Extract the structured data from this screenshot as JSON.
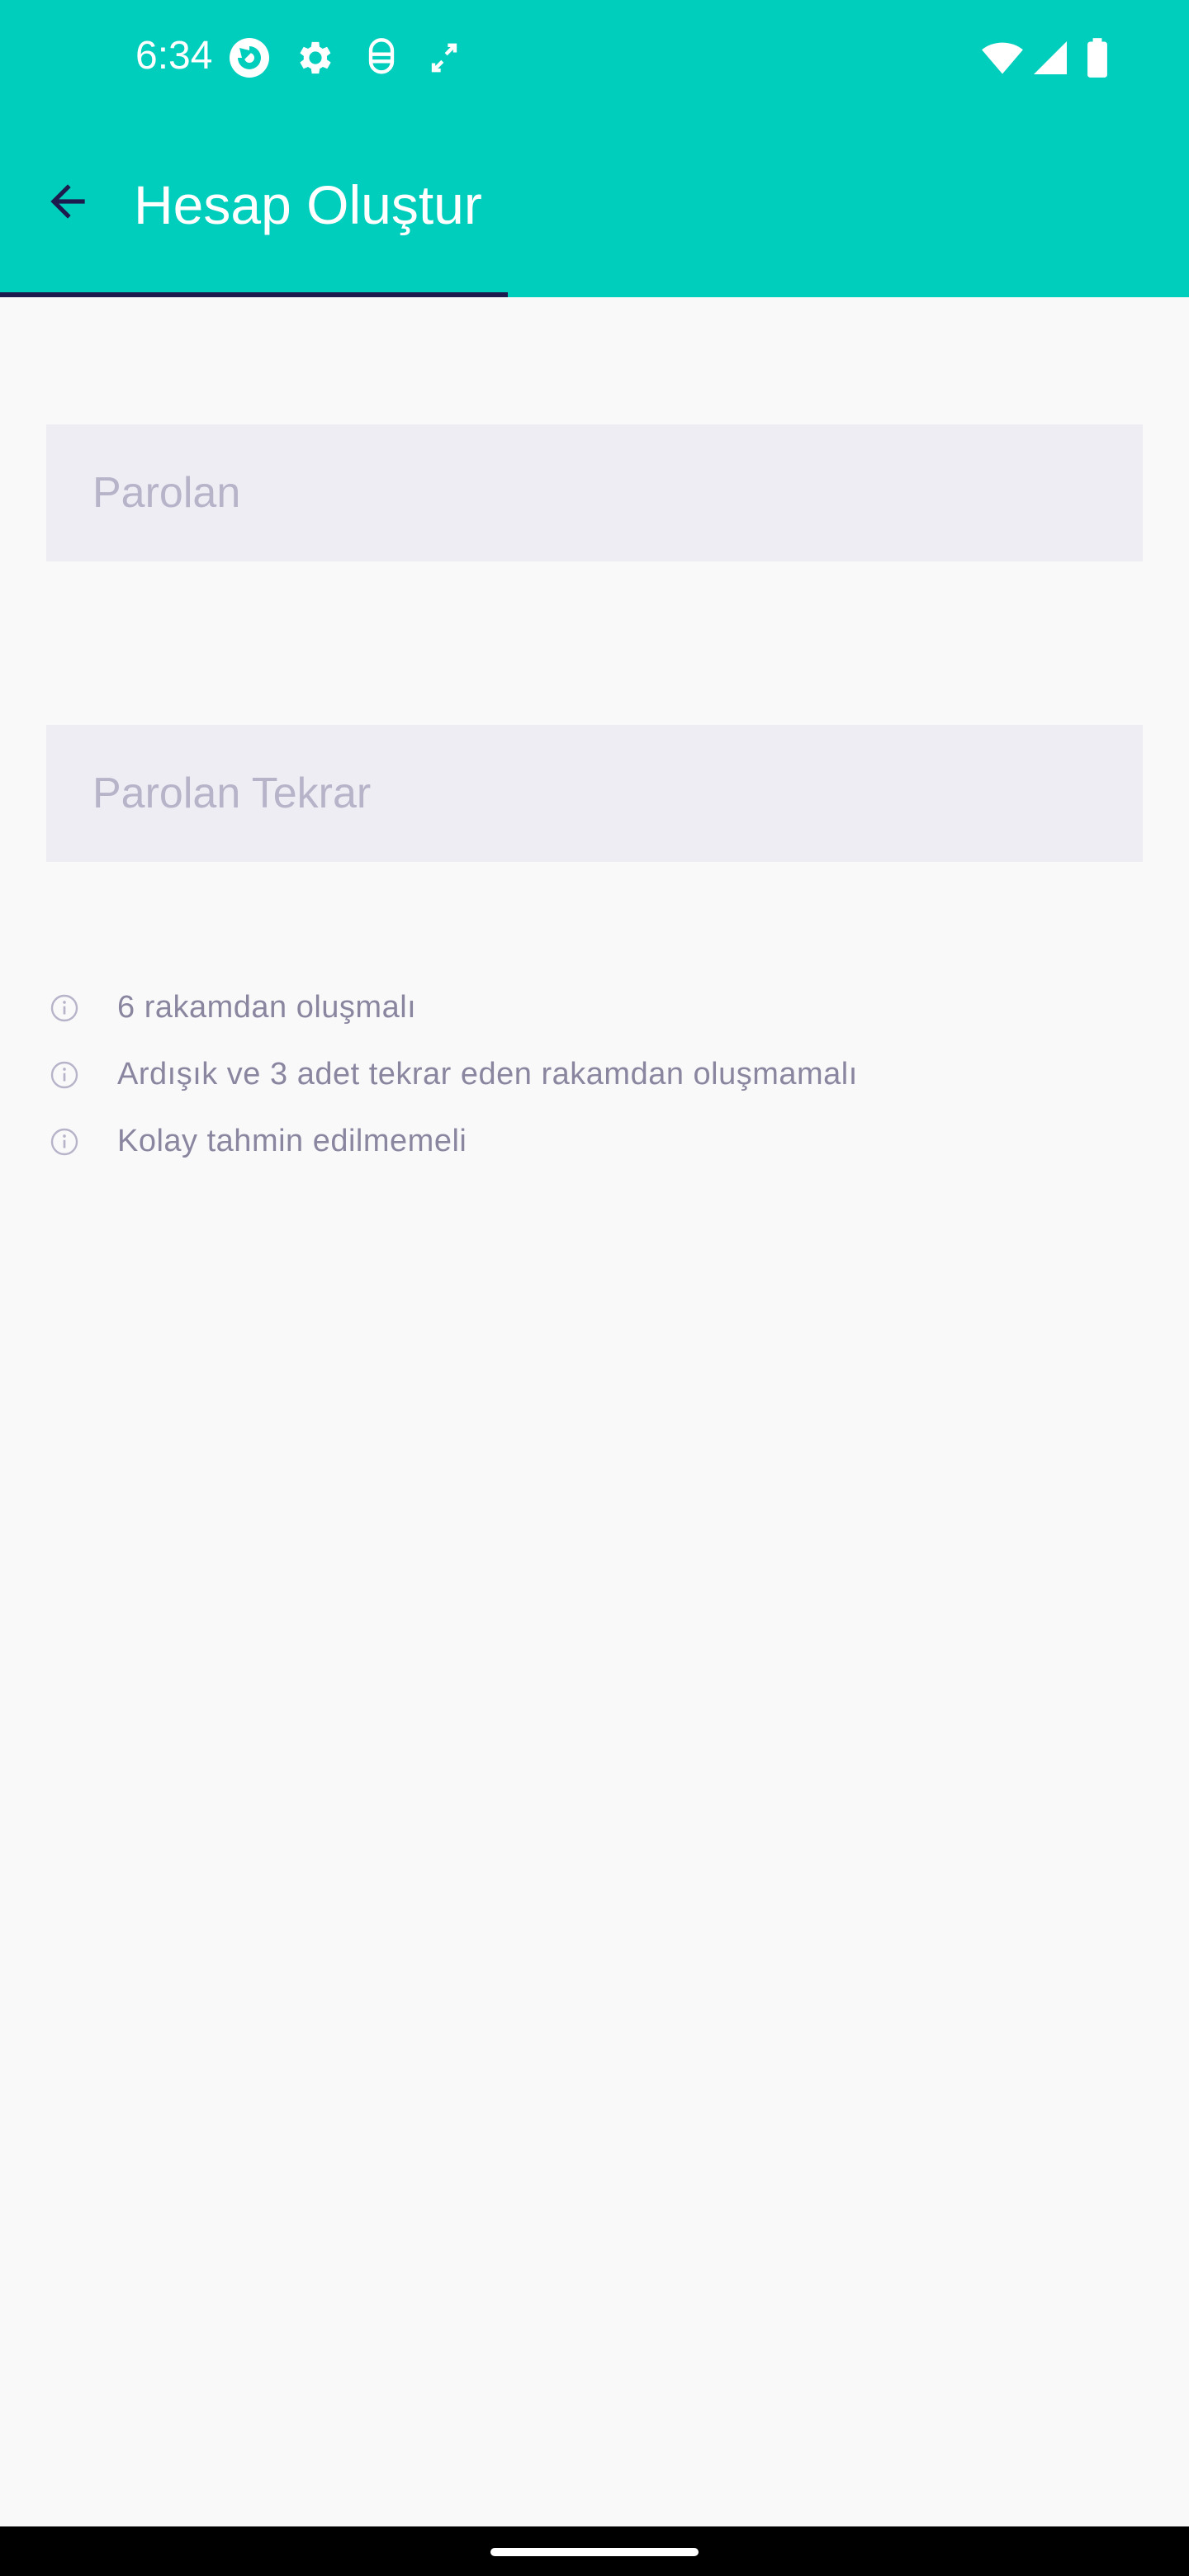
{
  "status_bar": {
    "time": "6:34",
    "icons": [
      "firefox-focus-icon",
      "settings-icon",
      "android-debug-icon",
      "screen-rotate-icon"
    ],
    "right_icons": [
      "wifi-icon",
      "signal-icon",
      "battery-icon"
    ],
    "background_color": "#00cebc"
  },
  "app_bar": {
    "title": "Hesap Oluştur",
    "back_icon": "arrow-back-icon",
    "progress": 0.427,
    "progress_color": "#1d1a4e"
  },
  "form": {
    "password_placeholder": "Parolan",
    "password_value": "",
    "password_repeat_placeholder": "Parolan Tekrar",
    "password_repeat_value": ""
  },
  "rules": [
    {
      "icon": "info-icon",
      "text": "6 rakamdan oluşmalı"
    },
    {
      "icon": "info-icon",
      "text": "Ardışık ve 3 adet tekrar eden rakamdan oluşmamalı"
    },
    {
      "icon": "info-icon",
      "text": "Kolay tahmin edilmemeli"
    }
  ]
}
